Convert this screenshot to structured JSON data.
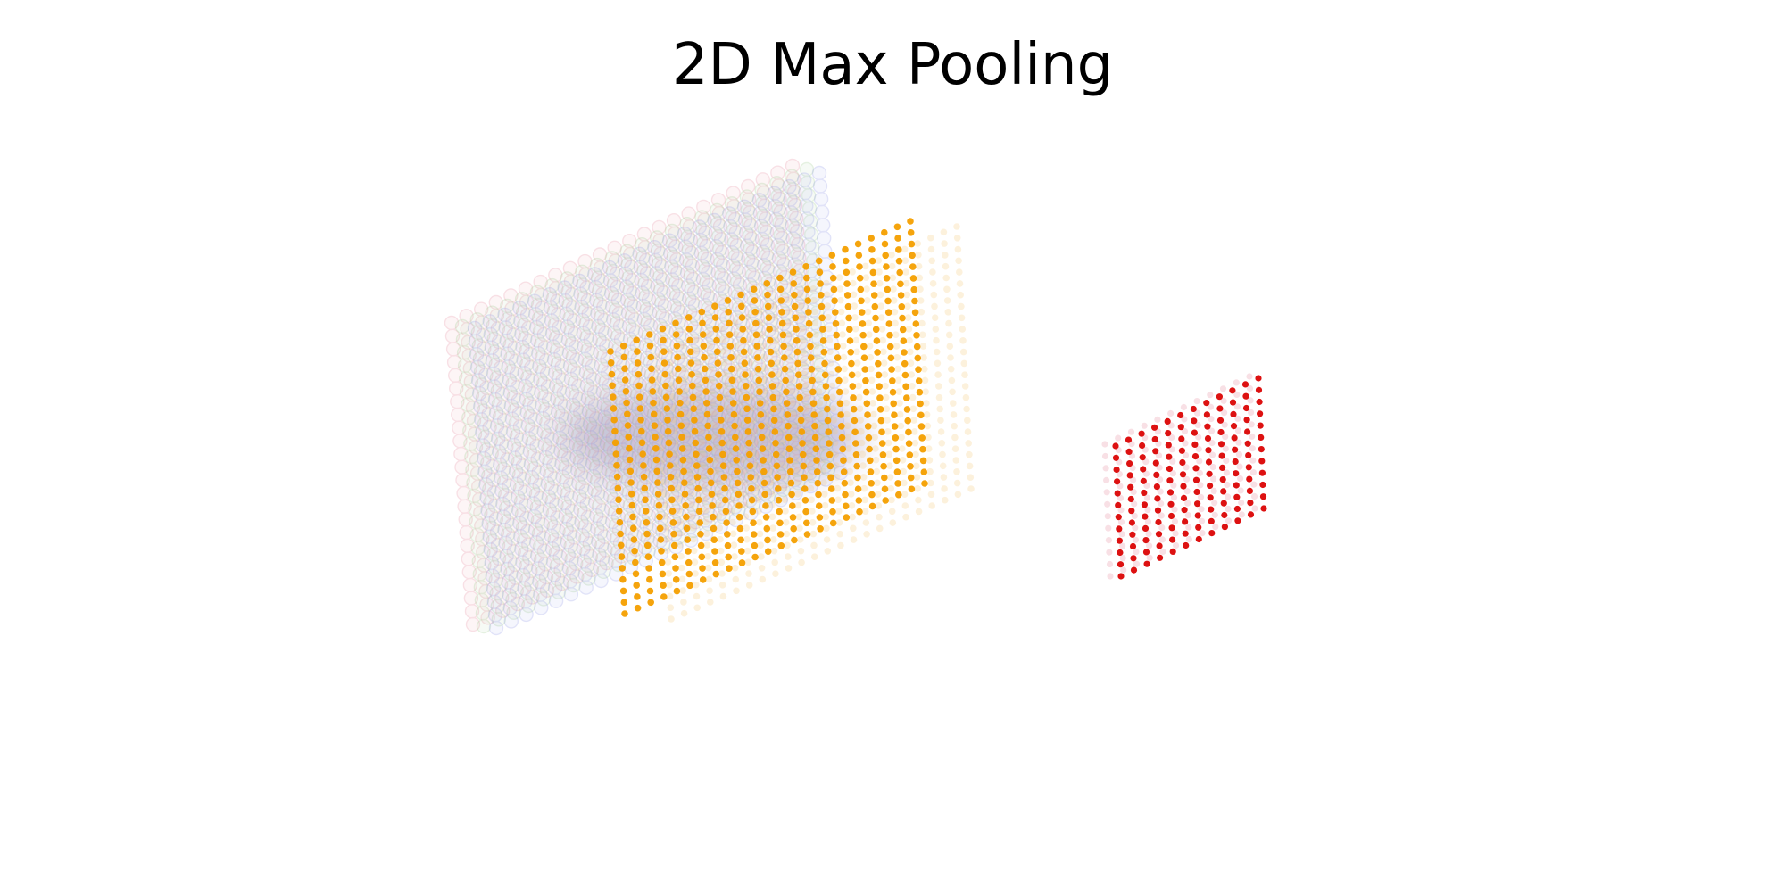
{
  "title": "2D Max Pooling",
  "layers": [
    {
      "name": "input-channel-red",
      "role": "input",
      "rows": 24,
      "cols": 24,
      "color": "#e6889b",
      "opacity": 0.25
    },
    {
      "name": "input-channel-green",
      "role": "input",
      "rows": 24,
      "cols": 24,
      "color": "#9ac98a",
      "opacity": 0.25
    },
    {
      "name": "input-channel-blue",
      "role": "input",
      "rows": 24,
      "cols": 24,
      "color": "#8c93e6",
      "opacity": 0.25
    },
    {
      "name": "feature-map-front",
      "role": "feature-map",
      "rows": 24,
      "cols": 24,
      "color": "#f5a000",
      "opacity": 0.95
    },
    {
      "name": "feature-map-back",
      "role": "feature-map",
      "rows": 24,
      "cols": 24,
      "color": "#f7c878",
      "opacity": 0.25
    },
    {
      "name": "pooled-output-ghost",
      "role": "pooled",
      "rows": 12,
      "cols": 12,
      "color": "#e6889b",
      "opacity": 0.25
    },
    {
      "name": "pooled-output",
      "role": "pooled",
      "rows": 12,
      "cols": 12,
      "color": "#dd1111",
      "opacity": 1.0
    }
  ]
}
